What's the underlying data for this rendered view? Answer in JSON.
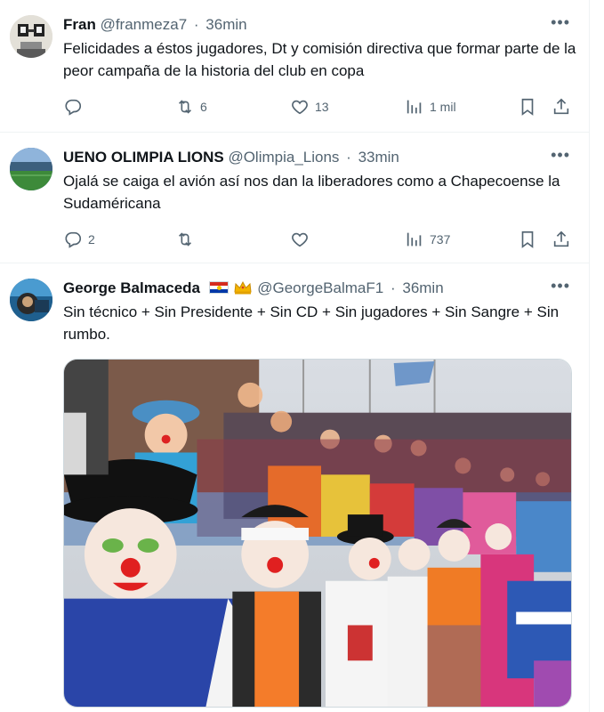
{
  "tweets": [
    {
      "name": "Fran",
      "handle": "@franmeza7",
      "time": "36min",
      "text": "Felicidades a éstos jugadores, Dt y comisión directiva que formar parte de la peor campaña de la historia del club en copa",
      "replies": "",
      "retweets": "6",
      "likes": "13",
      "views": "1 mil"
    },
    {
      "name": "UENO OLIMPIA LIONS",
      "handle": "@Olimpia_Lions",
      "time": "33min",
      "text": "Ojalá se caiga el avión así nos dan la liberadores como a Chapecoense la Sudaméricana",
      "replies": "2",
      "retweets": "",
      "likes": "",
      "views": "737"
    },
    {
      "name": "George Balmaceda",
      "handle": "@GeorgeBalmaF1",
      "time": "36min",
      "text": "Sin técnico + Sin Presidente + Sin CD + Sin jugadores + Sin Sangre + Sin rumbo.",
      "media": "photo"
    }
  ],
  "separator": "·",
  "more": "•••",
  "icons": {
    "reply": "reply-icon",
    "retweet": "retweet-icon",
    "like": "heart-icon",
    "views": "views-icon",
    "bookmark": "bookmark-icon",
    "share": "share-icon",
    "flag": "paraguay-flag-icon",
    "crown": "crown-icon"
  },
  "colors": {
    "text": "#0f1419",
    "secondary": "#536471",
    "border": "#eff3f4"
  }
}
